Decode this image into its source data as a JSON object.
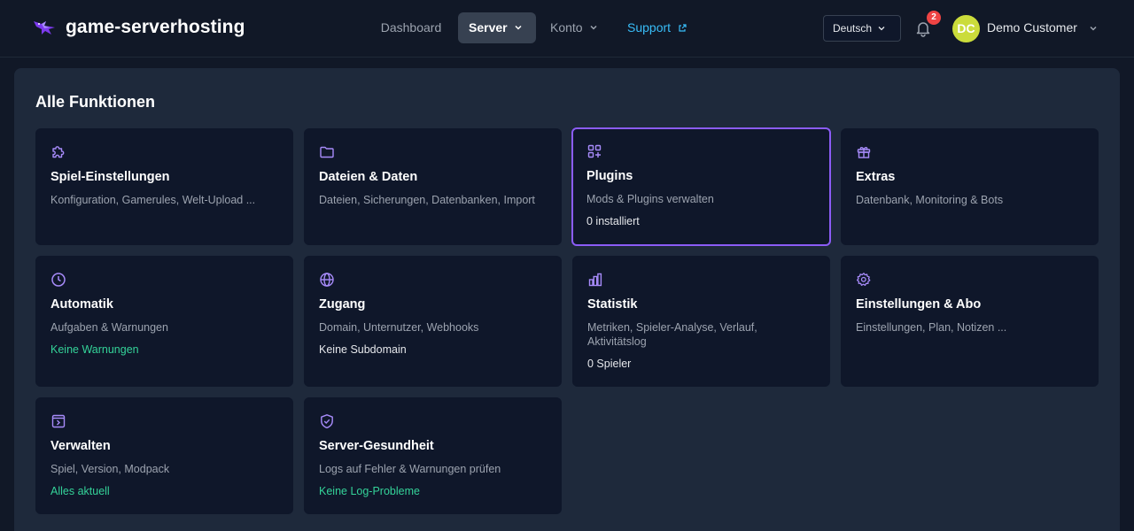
{
  "header": {
    "brand": "game-serverhosting",
    "nav": {
      "dashboard": "Dashboard",
      "server": "Server",
      "konto": "Konto",
      "support": "Support"
    },
    "language": "Deutsch",
    "notifications_count": "2",
    "user": {
      "initials": "DC",
      "name": "Demo Customer"
    }
  },
  "main": {
    "title": "Alle Funktionen",
    "cards": [
      {
        "title": "Spiel-Einstellungen",
        "desc": "Konfiguration, Gamerules, Welt-Upload ...",
        "status": "",
        "icon": "puzzle-icon"
      },
      {
        "title": "Dateien & Daten",
        "desc": "Dateien, Sicherungen, Datenbanken, Import",
        "status": "",
        "icon": "folder-icon"
      },
      {
        "title": "Plugins",
        "desc": "Mods & Plugins verwalten",
        "status": "0 installiert",
        "icon": "apps-add-icon"
      },
      {
        "title": "Extras",
        "desc": "Datenbank, Monitoring & Bots",
        "status": "",
        "icon": "gift-icon"
      },
      {
        "title": "Automatik",
        "desc": "Aufgaben & Warnungen",
        "status": "Keine Warnungen",
        "icon": "clock-icon"
      },
      {
        "title": "Zugang",
        "desc": "Domain, Unternutzer, Webhooks",
        "status": "Keine Subdomain",
        "icon": "globe-icon"
      },
      {
        "title": "Statistik",
        "desc": "Metriken, Spieler-Analyse, Verlauf, Aktivitätslog",
        "status": "0 Spieler",
        "icon": "bar-chart-icon"
      },
      {
        "title": "Einstellungen & Abo",
        "desc": "Einstellungen, Plan, Notizen ...",
        "status": "",
        "icon": "gear-icon"
      },
      {
        "title": "Verwalten",
        "desc": "Spiel, Version, Modpack",
        "status": "Alles aktuell",
        "icon": "terminal-window-icon"
      },
      {
        "title": "Server-Gesundheit",
        "desc": "Logs auf Fehler & Warnungen prüfen",
        "status": "Keine Log-Probleme",
        "icon": "shield-check-icon"
      }
    ]
  },
  "colors": {
    "accent": "#8b5cf6",
    "icon": "#a78bfa",
    "success": "#34d399",
    "link": "#38bdf8",
    "badge": "#ef4444",
    "avatar": "#cbdc3b"
  }
}
